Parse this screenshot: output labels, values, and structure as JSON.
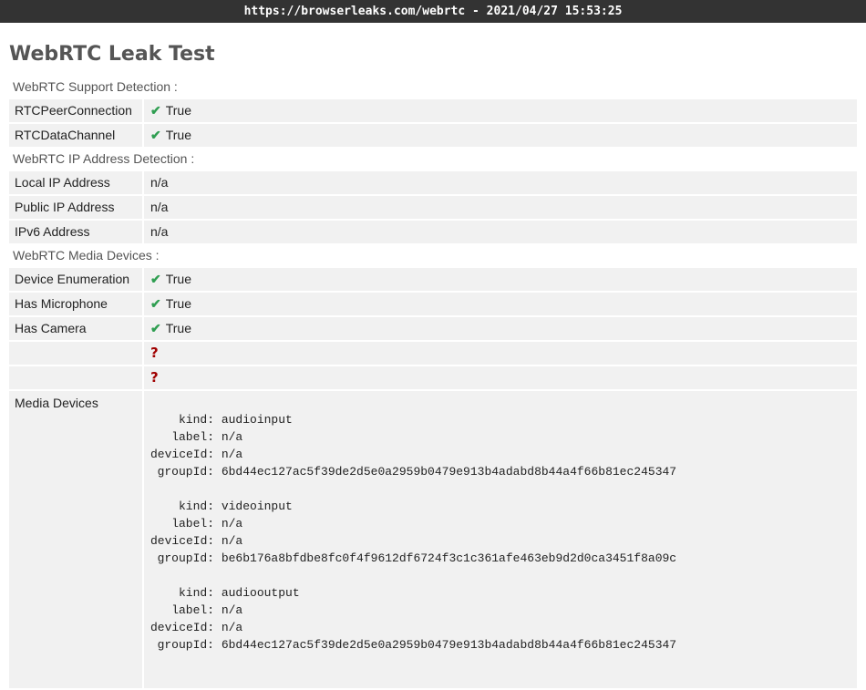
{
  "url_bar": {
    "text": "https://browserleaks.com/webrtc - 2021/04/27 15:53:25"
  },
  "page": {
    "title": "WebRTC Leak Test"
  },
  "sections": {
    "support": {
      "label": "WebRTC Support Detection :",
      "rows": [
        {
          "key": "RTCPeerConnection",
          "value": "True"
        },
        {
          "key": "RTCDataChannel",
          "value": "True"
        }
      ]
    },
    "ip": {
      "label": "WebRTC IP Address Detection :",
      "rows": [
        {
          "key": "Local IP Address",
          "value": "n/a"
        },
        {
          "key": "Public IP Address",
          "value": "n/a"
        },
        {
          "key": "IPv6 Address",
          "value": "n/a"
        }
      ]
    },
    "media": {
      "label": "WebRTC Media Devices :",
      "rows": [
        {
          "key": "Device Enumeration",
          "value": "True"
        },
        {
          "key": "Has Microphone",
          "value": "True"
        },
        {
          "key": "Has Camera",
          "value": "True"
        }
      ],
      "unknown": [
        "?",
        "?"
      ],
      "devices_label": "Media Devices",
      "field_labels": {
        "kind": "kind:",
        "label": "label:",
        "deviceId": "deviceId:",
        "groupId": "groupId:"
      },
      "devices": [
        {
          "kind": "audioinput",
          "label": "n/a",
          "deviceId": "n/a",
          "groupId": "6bd44ec127ac5f39de2d5e0a2959b0479e913b4adabd8b44a4f66b81ec245347"
        },
        {
          "kind": "videoinput",
          "label": "n/a",
          "deviceId": "n/a",
          "groupId": "be6b176a8bfdbe8fc0f4f9612df6724f3c1c361afe463eb9d2d0ca3451f8a09c"
        },
        {
          "kind": "audiooutput",
          "label": "n/a",
          "deviceId": "n/a",
          "groupId": "6bd44ec127ac5f39de2d5e0a2959b0479e913b4adabd8b44a4f66b81ec245347"
        }
      ]
    }
  },
  "icons": {
    "check": "check-icon",
    "question": "question-icon"
  },
  "colors": {
    "check": "#2f9e51",
    "question": "#a00000",
    "topbar": "#333333"
  }
}
